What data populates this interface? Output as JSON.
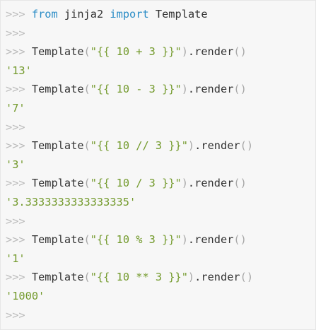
{
  "console": {
    "prompt": ">>>",
    "lines": [
      {
        "kind": "import",
        "kw1": "from",
        "module": "jinja2",
        "kw2": "import",
        "name": "Template"
      },
      {
        "kind": "empty"
      },
      {
        "kind": "call",
        "fn": "Template",
        "arg": "\"{{ 10 + 3 }}\"",
        "method": "render"
      },
      {
        "kind": "output",
        "value": "'13'"
      },
      {
        "kind": "call",
        "fn": "Template",
        "arg": "\"{{ 10 - 3 }}\"",
        "method": "render"
      },
      {
        "kind": "output",
        "value": "'7'"
      },
      {
        "kind": "empty"
      },
      {
        "kind": "call",
        "fn": "Template",
        "arg": "\"{{ 10 // 3 }}\"",
        "method": "render"
      },
      {
        "kind": "output",
        "value": "'3'"
      },
      {
        "kind": "call",
        "fn": "Template",
        "arg": "\"{{ 10 / 3 }}\"",
        "method": "render"
      },
      {
        "kind": "output",
        "value": "'3.3333333333333335'"
      },
      {
        "kind": "empty"
      },
      {
        "kind": "call",
        "fn": "Template",
        "arg": "\"{{ 10 % 3 }}\"",
        "method": "render"
      },
      {
        "kind": "output",
        "value": "'1'"
      },
      {
        "kind": "call",
        "fn": "Template",
        "arg": "\"{{ 10 ** 3 }}\"",
        "method": "render"
      },
      {
        "kind": "output",
        "value": "'1000'"
      },
      {
        "kind": "empty"
      }
    ],
    "colors": {
      "prompt": "#bcbcbc",
      "keyword": "#2a8cc6",
      "string": "#739a2c",
      "punctuation": "#a8a8a8",
      "text": "#333333",
      "background": "#f7f7f7"
    }
  }
}
